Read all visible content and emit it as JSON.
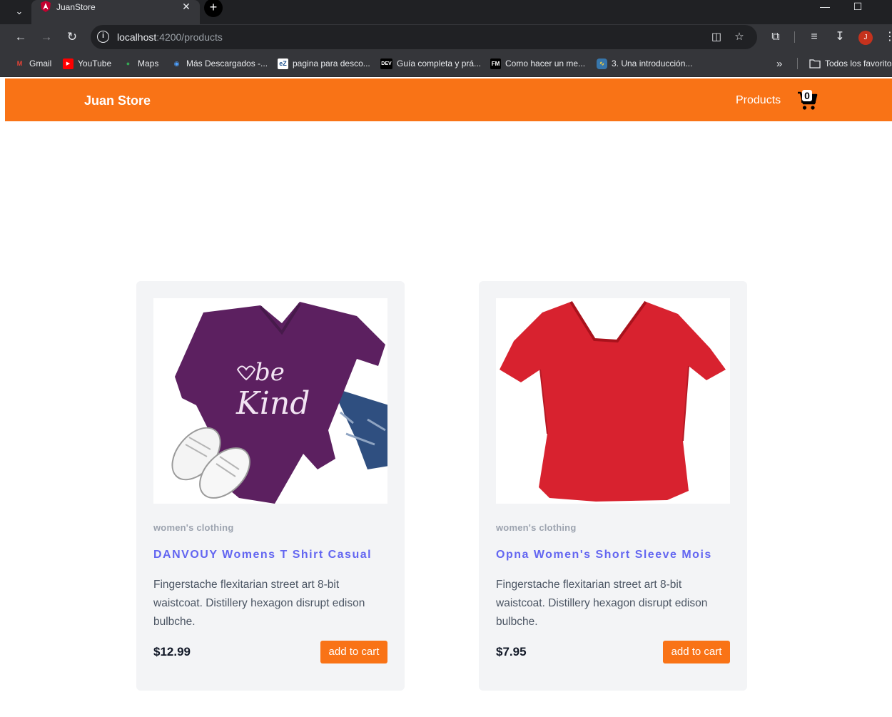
{
  "browser": {
    "tab_title": "JuanStore",
    "url_host": "localhost",
    "url_path": ":4200/products",
    "profile_initial": "J",
    "bookmarks": [
      {
        "label": "Gmail",
        "icon": "gmail-icon"
      },
      {
        "label": "YouTube",
        "icon": "youtube-icon"
      },
      {
        "label": "Maps",
        "icon": "maps-icon"
      },
      {
        "label": "Más Descargados -...",
        "icon": "eye-icon"
      },
      {
        "label": "pagina para desco...",
        "icon": "ez-icon"
      },
      {
        "label": "Guía completa y prá...",
        "icon": "dev-icon"
      },
      {
        "label": "Como hacer un me...",
        "icon": "fm-icon"
      },
      {
        "label": "3. Una introducción...",
        "icon": "python-icon"
      }
    ],
    "bookmarks_overflow": "»",
    "all_bookmarks": "Todos los favoritos"
  },
  "site": {
    "brand": "Juan Store",
    "nav_products": "Products",
    "cart_count": "0",
    "accent_color": "#f97316",
    "title_color": "#6366f1"
  },
  "products": [
    {
      "category": "women's clothing",
      "title": "DANVOUY Womens T Shirt Casual",
      "description": "Fingerstache flexitarian street art 8-bit waistcoat. Distillery hexagon disrupt edison bulbche.",
      "price": "$12.99",
      "button": "add to cart",
      "image_text_1": "be",
      "image_text_2": "Kind"
    },
    {
      "category": "women's clothing",
      "title": "Opna Women's Short Sleeve Mois",
      "description": "Fingerstache flexitarian street art 8-bit waistcoat. Distillery hexagon disrupt edison bulbche.",
      "price": "$7.95",
      "button": "add to cart"
    }
  ]
}
